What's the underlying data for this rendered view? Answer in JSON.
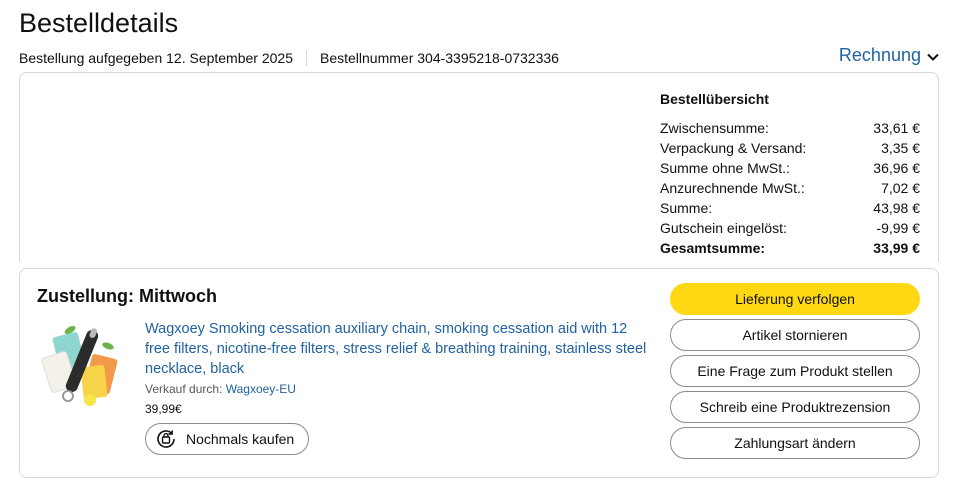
{
  "page": {
    "title": "Bestelldetails"
  },
  "meta": {
    "order_placed": "Bestellung aufgegeben 12. September 2025",
    "order_number": "Bestellnummer 304-3395218-0732336"
  },
  "invoice": {
    "label": "Rechnung"
  },
  "summary": {
    "title": "Bestellübersicht",
    "rows": [
      {
        "label": "Zwischensumme:",
        "value": "33,61 €"
      },
      {
        "label": "Verpackung & Versand:",
        "value": "3,35 €"
      },
      {
        "label": "Summe ohne MwSt.:",
        "value": "36,96 €"
      },
      {
        "label": "Anzurechnende MwSt.:",
        "value": "7,02 €"
      },
      {
        "label": "Summe:",
        "value": "43,98 €"
      },
      {
        "label": "Gutschein eingelöst:",
        "value": "-9,99 €"
      }
    ],
    "total": {
      "label": "Gesamtsumme:",
      "value": "33,99 €"
    }
  },
  "delivery": {
    "title": "Zustellung: Mittwoch",
    "product": {
      "title": "Wagxoey Smoking cessation auxiliary chain, smoking cessation aid with 12 free filters, nicotine-free filters, stress relief & breathing training, stainless steel necklace, black",
      "seller_prefix": "Verkauf durch: ",
      "seller": "Wagxoey-EU",
      "price": "39,99€",
      "buy_again": "Nochmals kaufen"
    },
    "actions": {
      "track": "Lieferung verfolgen",
      "cancel": "Artikel stornieren",
      "question": "Eine Frage zum Produkt stellen",
      "review": "Schreib eine Produktrezension",
      "payment": "Zahlungsart ändern"
    }
  },
  "colors": {
    "link": "#2162a1",
    "primary_button": "#ffd814",
    "border": "#d5d9d9"
  },
  "icons": [
    "chevron-down-icon",
    "buy-again-icon",
    "product-image"
  ]
}
